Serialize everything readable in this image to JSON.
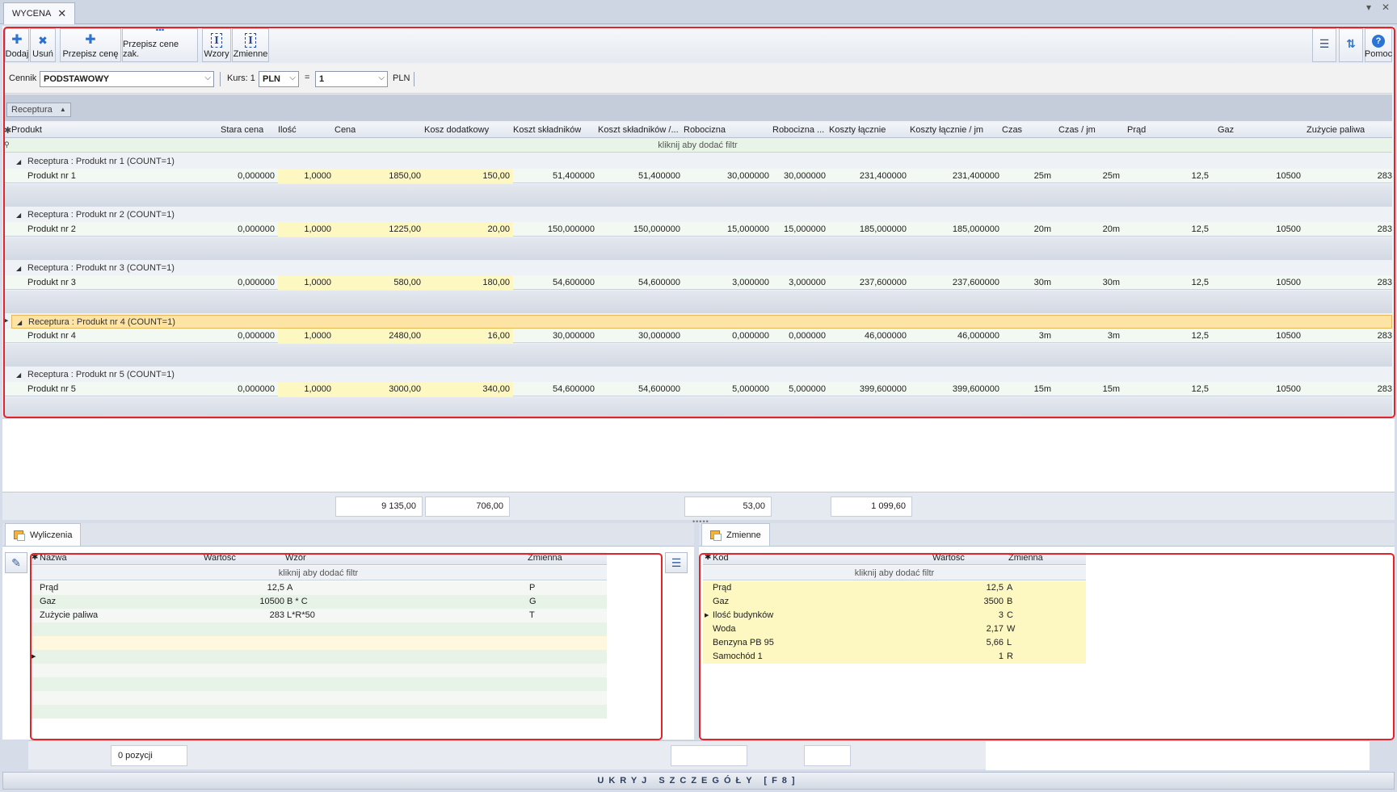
{
  "tab": {
    "title": "WYCENA"
  },
  "toolbar": {
    "buttons": [
      {
        "label": "Dodaj",
        "icon": "plus-icon"
      },
      {
        "label": "Usuń",
        "icon": "x-icon"
      },
      {
        "label": "Przepisz cenę",
        "icon": "plus-icon"
      },
      {
        "label": "Przepisz cene zak.",
        "icon": "link-icon"
      },
      {
        "label": "Wzory",
        "icon": "cursor-icon"
      },
      {
        "label": "Zmienne",
        "icon": "cursor-icon"
      }
    ],
    "help_label": "Pomoc"
  },
  "filterbar": {
    "cennik_label": "Cennik",
    "cennik_value": "PODSTAWOWY",
    "kurs_label": "Kurs: 1",
    "kurs_currency": "PLN",
    "equals": "=",
    "kurs_value": "1",
    "target_currency": "PLN"
  },
  "groupby": {
    "chip": "Receptura"
  },
  "grid": {
    "columns": [
      "Produkt",
      "Stara cena",
      "Ilość",
      "Cena",
      "Kosz dodatkowy",
      "Koszt składników",
      "Koszt składników /...",
      "Robocizna",
      "Robocizna ...",
      "Koszty łącznie",
      "Koszty łącznie / jm",
      "Czas",
      "Czas / jm",
      "Prąd",
      "Gaz",
      "Zużycie paliwa"
    ],
    "filter_hint": "kliknij aby dodać filtr",
    "groups": [
      {
        "header": "Receptura : Produkt nr 1 (COUNT=1)",
        "row": [
          "Produkt nr 1",
          "0,000000",
          "1,0000",
          "1850,00",
          "150,00",
          "51,400000",
          "51,400000",
          "30,000000",
          "30,000000",
          "231,400000",
          "231,400000",
          "25m",
          "25m",
          "12,5",
          "10500",
          "283"
        ]
      },
      {
        "header": "Receptura : Produkt nr 2 (COUNT=1)",
        "row": [
          "Produkt nr 2",
          "0,000000",
          "1,0000",
          "1225,00",
          "20,00",
          "150,000000",
          "150,000000",
          "15,000000",
          "15,000000",
          "185,000000",
          "185,000000",
          "20m",
          "20m",
          "12,5",
          "10500",
          "283"
        ]
      },
      {
        "header": "Receptura : Produkt nr 3 (COUNT=1)",
        "row": [
          "Produkt nr 3",
          "0,000000",
          "1,0000",
          "580,00",
          "180,00",
          "54,600000",
          "54,600000",
          "3,000000",
          "3,000000",
          "237,600000",
          "237,600000",
          "30m",
          "30m",
          "12,5",
          "10500",
          "283"
        ]
      },
      {
        "header": "Receptura : Produkt nr 4 (COUNT=1)",
        "row": [
          "Produkt nr 4",
          "0,000000",
          "1,0000",
          "2480,00",
          "16,00",
          "30,000000",
          "30,000000",
          "0,000000",
          "0,000000",
          "46,000000",
          "46,000000",
          "3m",
          "3m",
          "12,5",
          "10500",
          "283"
        ]
      },
      {
        "header": "Receptura : Produkt nr 5 (COUNT=1)",
        "row": [
          "Produkt nr 5",
          "0,000000",
          "1,0000",
          "3000,00",
          "340,00",
          "54,600000",
          "54,600000",
          "5,000000",
          "5,000000",
          "399,600000",
          "399,600000",
          "15m",
          "15m",
          "12,5",
          "10500",
          "283"
        ]
      }
    ]
  },
  "totals": [
    "9 135,00",
    "706,00",
    "53,00",
    "1 099,60"
  ],
  "wyliczenia": {
    "tab": "Wyliczenia",
    "columns": [
      "Nazwa",
      "Wartość",
      "Wzór",
      "Zmienna"
    ],
    "filter_hint": "kliknij aby dodać filtr",
    "rows": [
      {
        "nazwa": "Prąd",
        "wartosc": "12,5",
        "wzor": "A",
        "zmienna": "P"
      },
      {
        "nazwa": "Gaz",
        "wartosc": "10500",
        "wzor": "B * C",
        "zmienna": "G"
      },
      {
        "nazwa": "Zużycie paliwa",
        "wartosc": "283",
        "wzor": "L*R*50",
        "zmienna": "T"
      }
    ]
  },
  "zmienne": {
    "tab": "Zmienne",
    "columns": [
      "Kod",
      "Wartość",
      "Zmienna"
    ],
    "filter_hint": "kliknij aby dodać filtr",
    "rows": [
      {
        "kod": "Prąd",
        "wartosc": "12,5",
        "zmienna": "A"
      },
      {
        "kod": "Gaz",
        "wartosc": "3500",
        "zmienna": "B"
      },
      {
        "kod": "Ilość budynków",
        "wartosc": "3",
        "zmienna": "C"
      },
      {
        "kod": "Woda",
        "wartosc": "2,17",
        "zmienna": "W"
      },
      {
        "kod": "Benzyna PB 95",
        "wartosc": "5,66",
        "zmienna": "L"
      },
      {
        "kod": "Samochód 1",
        "wartosc": "1",
        "zmienna": "R"
      }
    ]
  },
  "status": {
    "positions": "0 pozycji"
  },
  "footer": {
    "hide_details": "UKRYJ SZCZEGÓŁY [F8]"
  }
}
